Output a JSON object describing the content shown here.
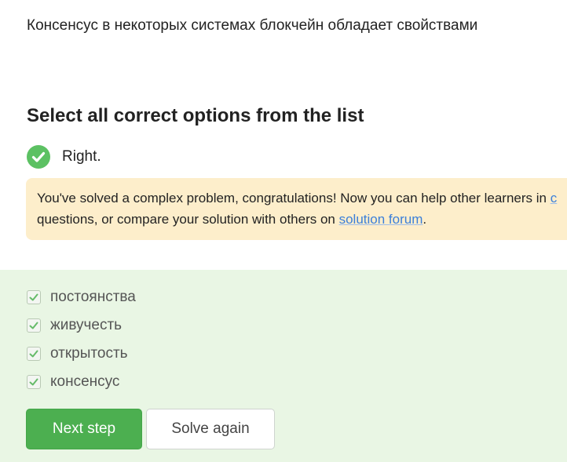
{
  "question": {
    "text": "Консенсус в некоторых системах блокчейн обладает свойствами"
  },
  "section": {
    "title": "Select all correct options from the list"
  },
  "status": {
    "icon": "check-circle-icon",
    "text": "Right.",
    "color": "#5cc163"
  },
  "notice": {
    "text_before": "You've solved a complex problem, congratulations! Now you can help other learners in ",
    "cutoff_link": "c",
    "text_line2": "questions, or compare your solution with others on ",
    "link": "solution forum",
    "text_after": ".",
    "background": "#fdeecb"
  },
  "options": [
    {
      "label": "постоянства",
      "checked": true
    },
    {
      "label": "живучесть",
      "checked": true
    },
    {
      "label": "открытость",
      "checked": true
    },
    {
      "label": "консенсус",
      "checked": true
    }
  ],
  "buttons": {
    "next_step": "Next step",
    "solve_again": "Solve again"
  },
  "colors": {
    "accent": "#4caf50",
    "panel": "#e9f6e4"
  }
}
